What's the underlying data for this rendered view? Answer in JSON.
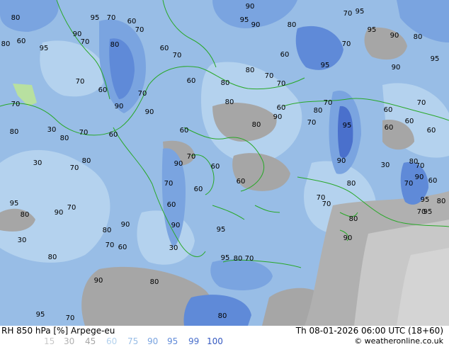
{
  "product": "RH 850 hPa [%] Arpege-eu",
  "valid_time": "Th 08-01-2026 06:00 UTC (18+60)",
  "credit": "© weatheronline.co.uk",
  "legend": [
    {
      "label": "15",
      "color": "#c8c8c8"
    },
    {
      "label": "30",
      "color": "#b0b0b0"
    },
    {
      "label": "45",
      "color": "#a6a6a6"
    },
    {
      "label": "60",
      "color": "#b4d2ee"
    },
    {
      "label": "75",
      "color": "#98bde6"
    },
    {
      "label": "90",
      "color": "#7aa4e0"
    },
    {
      "label": "95",
      "color": "#5f8ad8"
    },
    {
      "label": "99",
      "color": "#4a70cc"
    },
    {
      "label": "100",
      "color": "#3458c0"
    }
  ],
  "contour_labels": [
    "95",
    "70",
    "90",
    "80",
    "60",
    "70",
    "95",
    "90",
    "80",
    "70",
    "95",
    "90",
    "60",
    "80",
    "70",
    "95",
    "90",
    "80",
    "70",
    "60",
    "80",
    "95",
    "70",
    "60",
    "95",
    "80",
    "70",
    "90",
    "95",
    "70",
    "60",
    "80",
    "70",
    "60",
    "70",
    "80",
    "60",
    "90",
    "90",
    "70",
    "80",
    "60",
    "70",
    "70",
    "90",
    "80",
    "70",
    "95",
    "60",
    "70",
    "60",
    "80",
    "30",
    "60",
    "60",
    "80",
    "60",
    "70",
    "30",
    "70",
    "90",
    "60",
    "80",
    "90",
    "30",
    "60",
    "80",
    "70",
    "60",
    "80",
    "90",
    "70",
    "80",
    "95",
    "60",
    "70",
    "70",
    "80",
    "80",
    "70",
    "90",
    "80",
    "90",
    "90",
    "95",
    "90",
    "30",
    "70",
    "60",
    "30",
    "95",
    "80",
    "70",
    "80",
    "90",
    "80",
    "95",
    "80",
    "70",
    "95",
    "60",
    "70",
    "70",
    "95"
  ]
}
